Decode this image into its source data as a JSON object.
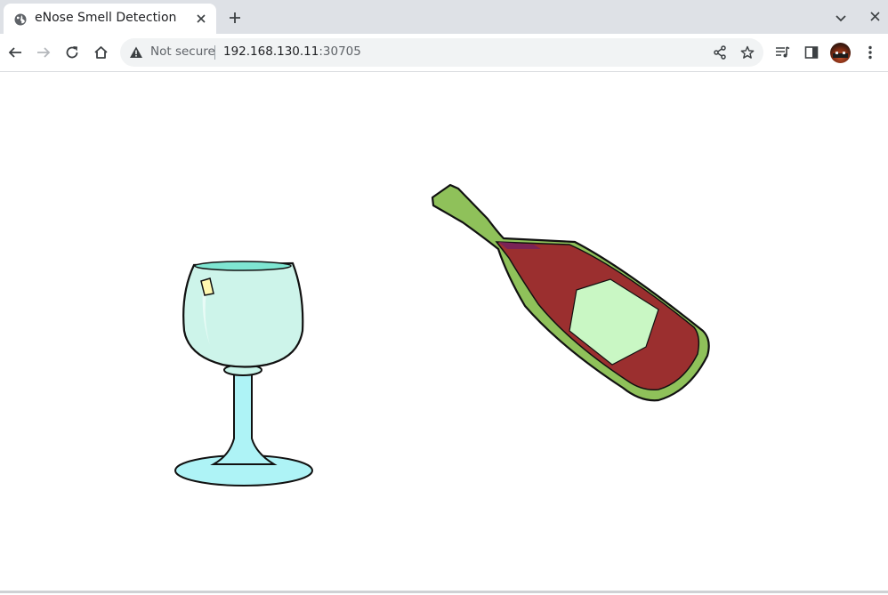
{
  "browser": {
    "tab": {
      "title": "eNose Smell Detection"
    },
    "omnibox": {
      "security_label": "Not secure",
      "host": "192.168.130.11",
      "port": ":30705"
    }
  },
  "page": {
    "images": [
      {
        "name": "wine-glass",
        "description": "cartoon wine glass"
      },
      {
        "name": "wine-bottle",
        "description": "cartoon red wine bottle"
      }
    ]
  },
  "colors": {
    "tabstrip_bg": "#dee1e6",
    "omnibox_bg": "#f1f3f4",
    "glass_fill": "#c8f5ea",
    "bottle_green": "#8fc15a",
    "wine_red": "#9b2f2f",
    "label_green": "#c9f7c4"
  }
}
